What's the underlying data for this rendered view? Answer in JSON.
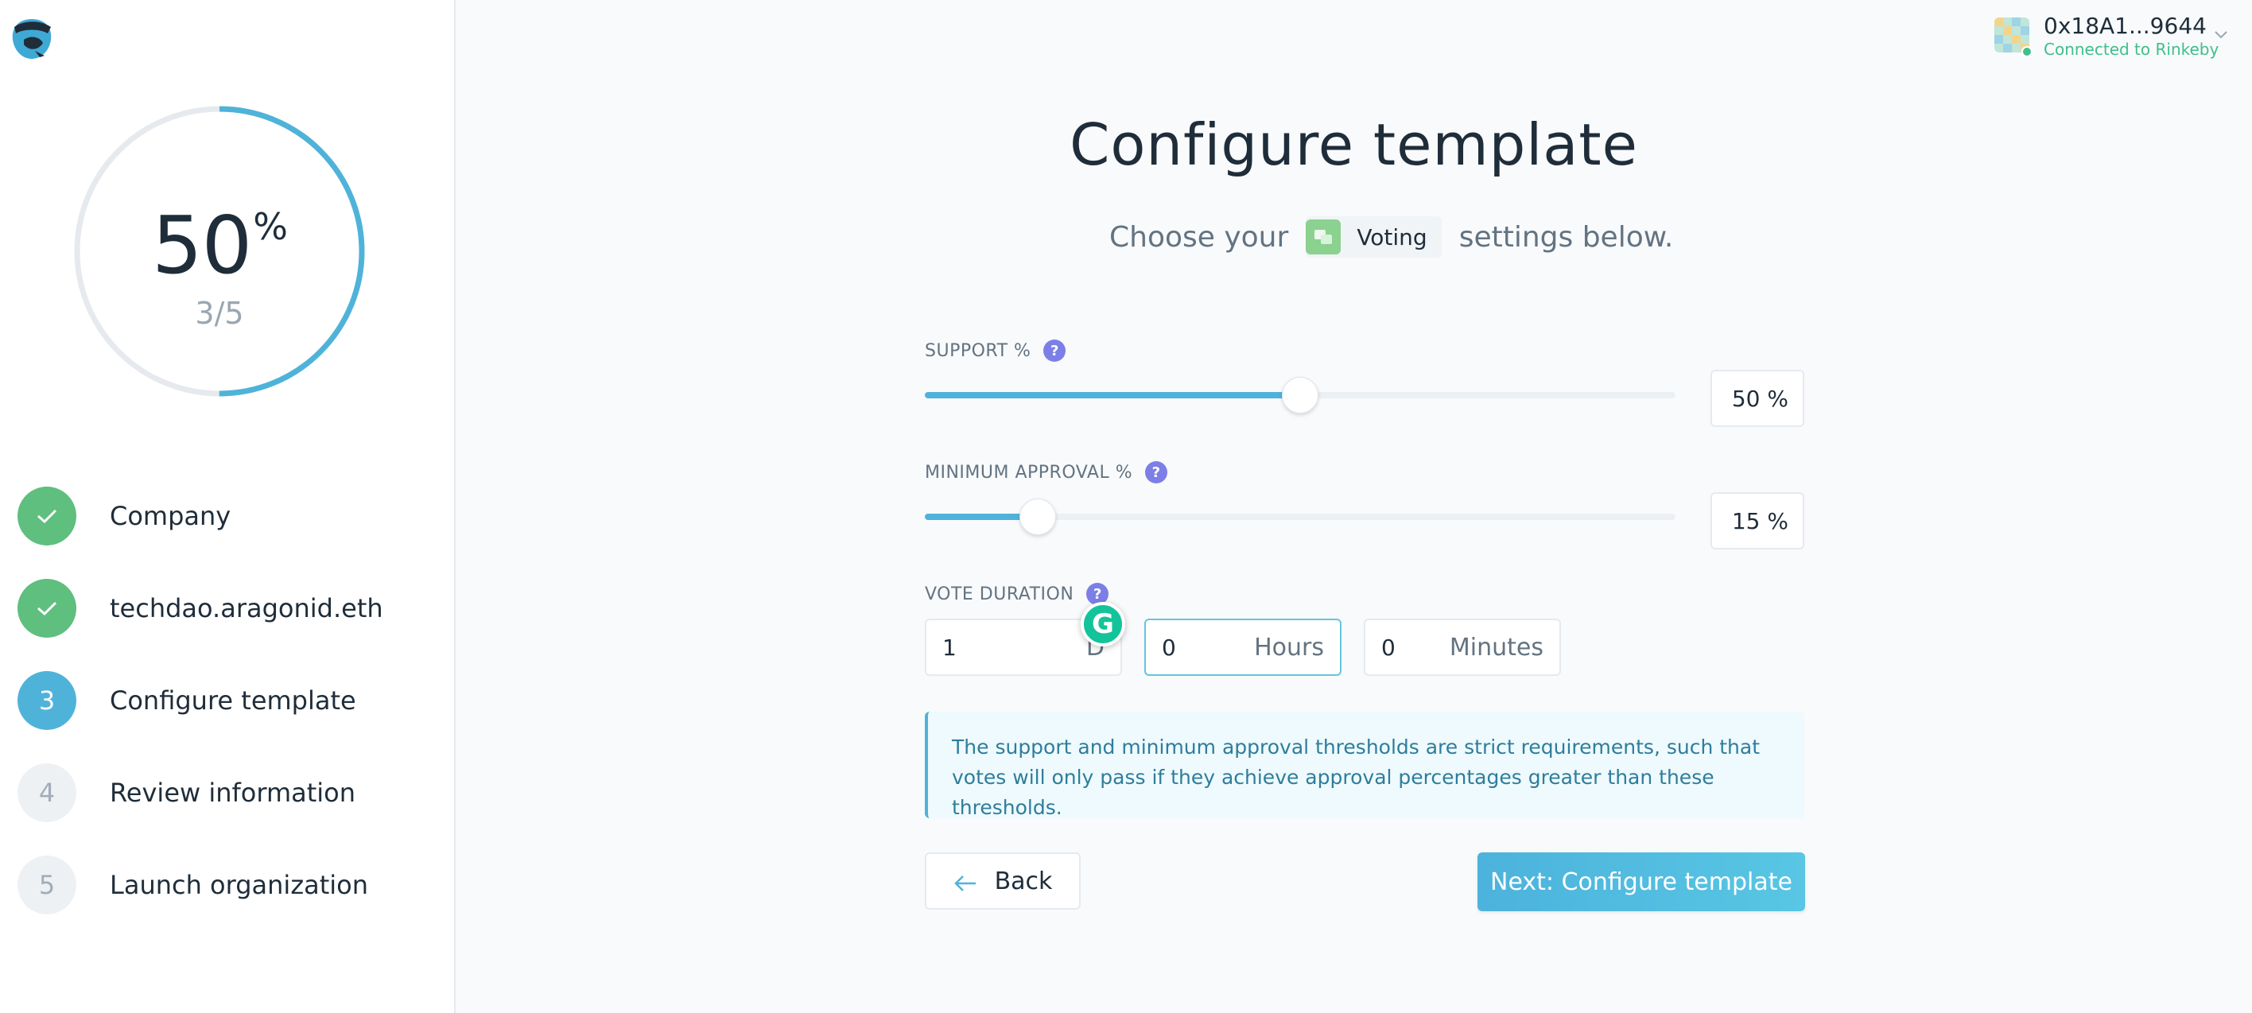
{
  "progress": {
    "percent": 50,
    "value": "50",
    "sign": "%",
    "count": "3/5"
  },
  "steps": [
    {
      "label": "Company",
      "state": "done",
      "marker": ""
    },
    {
      "label": "techdao.aragonid.eth",
      "state": "done",
      "marker": ""
    },
    {
      "label": "Configure template",
      "state": "active",
      "marker": "3"
    },
    {
      "label": "Review information",
      "state": "todo",
      "marker": "4"
    },
    {
      "label": "Launch organization",
      "state": "todo",
      "marker": "5"
    }
  ],
  "account": {
    "address": "0x18A1...9644",
    "status": "Connected to Rinkeby"
  },
  "main": {
    "title": "Configure template",
    "subtitle_before": "Choose your",
    "app_name": "Voting",
    "subtitle_after": "settings below."
  },
  "support": {
    "label": "SUPPORT %",
    "percent": 50,
    "display": "50 %"
  },
  "min_approval": {
    "label": "MINIMUM APPROVAL %",
    "percent": 15,
    "display": "15 %"
  },
  "duration": {
    "label": "VOTE DURATION",
    "days": {
      "value": "1",
      "unit": "D"
    },
    "hours": {
      "value": "0",
      "unit": "Hours"
    },
    "minutes": {
      "value": "0",
      "unit": "Minutes"
    }
  },
  "help_glyph": "?",
  "grammarly_glyph": "G",
  "info_text": "The support and minimum approval thresholds are strict requirements, such that votes will only pass if they achieve approval percentages greater than these thresholds.",
  "buttons": {
    "back": "Back",
    "next": "Next: Configure template"
  },
  "colors": {
    "accent": "#4fb3d9",
    "success": "#5fbf7e",
    "help": "#7c7fe6",
    "connected": "#3fbf8a"
  }
}
